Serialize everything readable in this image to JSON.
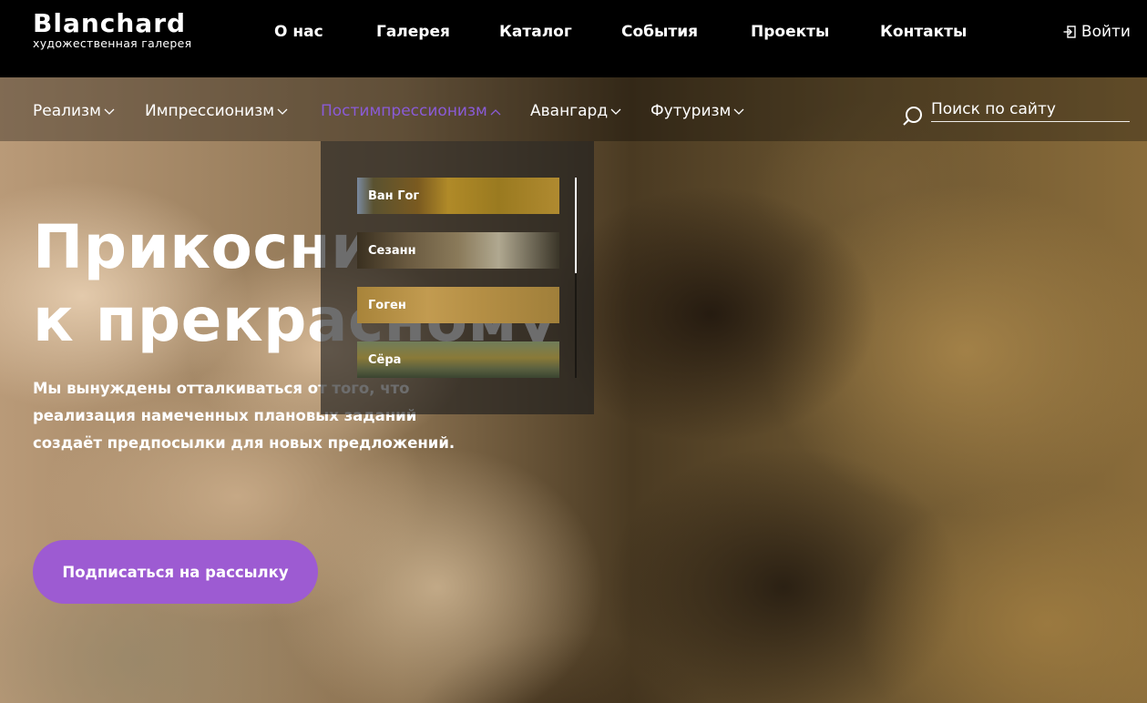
{
  "header": {
    "logo": {
      "name": "Blanchard",
      "subtitle": "художественная галерея"
    },
    "nav": [
      "О нас",
      "Галерея",
      "Каталог",
      "События",
      "Проекты",
      "Контакты"
    ],
    "login_label": "Войти"
  },
  "styles_nav": {
    "items": [
      {
        "label": "Реализм",
        "active": false
      },
      {
        "label": "Импрессионизм",
        "active": false
      },
      {
        "label": "Постимпрессионизм",
        "active": true
      },
      {
        "label": "Авангард",
        "active": false
      },
      {
        "label": "Футуризм",
        "active": false
      }
    ],
    "search_placeholder": "Поиск по сайту"
  },
  "dropdown": {
    "items": [
      "Ван Гог",
      "Сезанн",
      "Гоген",
      "Сёра"
    ]
  },
  "hero": {
    "title_line1": "Прикоснись",
    "title_line2": "к прекрасному",
    "text": "Мы вынуждены отталкиваться от того, что реализация намеченных плановых заданий создаёт предпосылки для новых предложений.",
    "cta_label": "Подписаться на рассылку"
  },
  "colors": {
    "accent": "#9d5bd2",
    "active_nav": "#8a5bd6",
    "header_bg": "#000000"
  }
}
